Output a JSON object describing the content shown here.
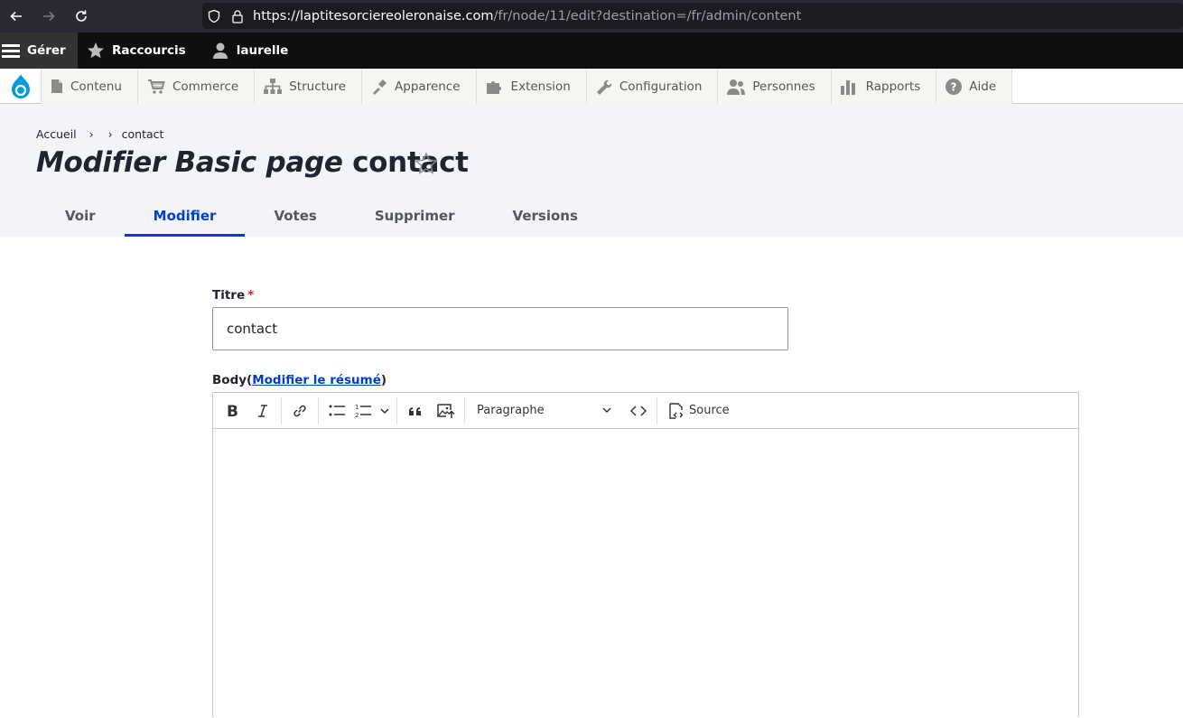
{
  "browser": {
    "url_host": "https://laptitesorciereoleronaise.com",
    "url_path": "/fr/node/11/edit?destination=/fr/admin/content"
  },
  "toolbar": {
    "manage": "Gérer",
    "shortcuts": "Raccourcis",
    "user": "laurelle"
  },
  "tray": {
    "items": [
      {
        "label": "Contenu",
        "icon": "document-icon"
      },
      {
        "label": "Commerce",
        "icon": "cart-icon"
      },
      {
        "label": "Structure",
        "icon": "sitemap-icon"
      },
      {
        "label": "Apparence",
        "icon": "brush-icon"
      },
      {
        "label": "Extension",
        "icon": "puzzle-icon"
      },
      {
        "label": "Configuration",
        "icon": "wrench-icon"
      },
      {
        "label": "Personnes",
        "icon": "people-icon"
      },
      {
        "label": "Rapports",
        "icon": "chart-icon"
      },
      {
        "label": "Aide",
        "icon": "help-icon"
      }
    ]
  },
  "breadcrumb": {
    "home": "Accueil",
    "sep": "›",
    "current": "contact"
  },
  "page": {
    "title_em": "Modifier Basic page",
    "title_rest": "contact"
  },
  "tabs": [
    {
      "label": "Voir",
      "active": false
    },
    {
      "label": "Modifier",
      "active": true
    },
    {
      "label": "Votes",
      "active": false
    },
    {
      "label": "Supprimer",
      "active": false
    },
    {
      "label": "Versions",
      "active": false
    }
  ],
  "form": {
    "title_label": "Titre",
    "required_mark": "*",
    "title_value": "contact",
    "body_label": "Body",
    "body_paren_open": " (",
    "summary_link": "Modifier le résumé",
    "body_paren_close": ")",
    "format_select": "Paragraphe",
    "source_label": "Source"
  },
  "colors": {
    "accent": "#003ecc",
    "toolbar_bg": "#0f0f0f",
    "header_bg": "#f3f4f9"
  }
}
